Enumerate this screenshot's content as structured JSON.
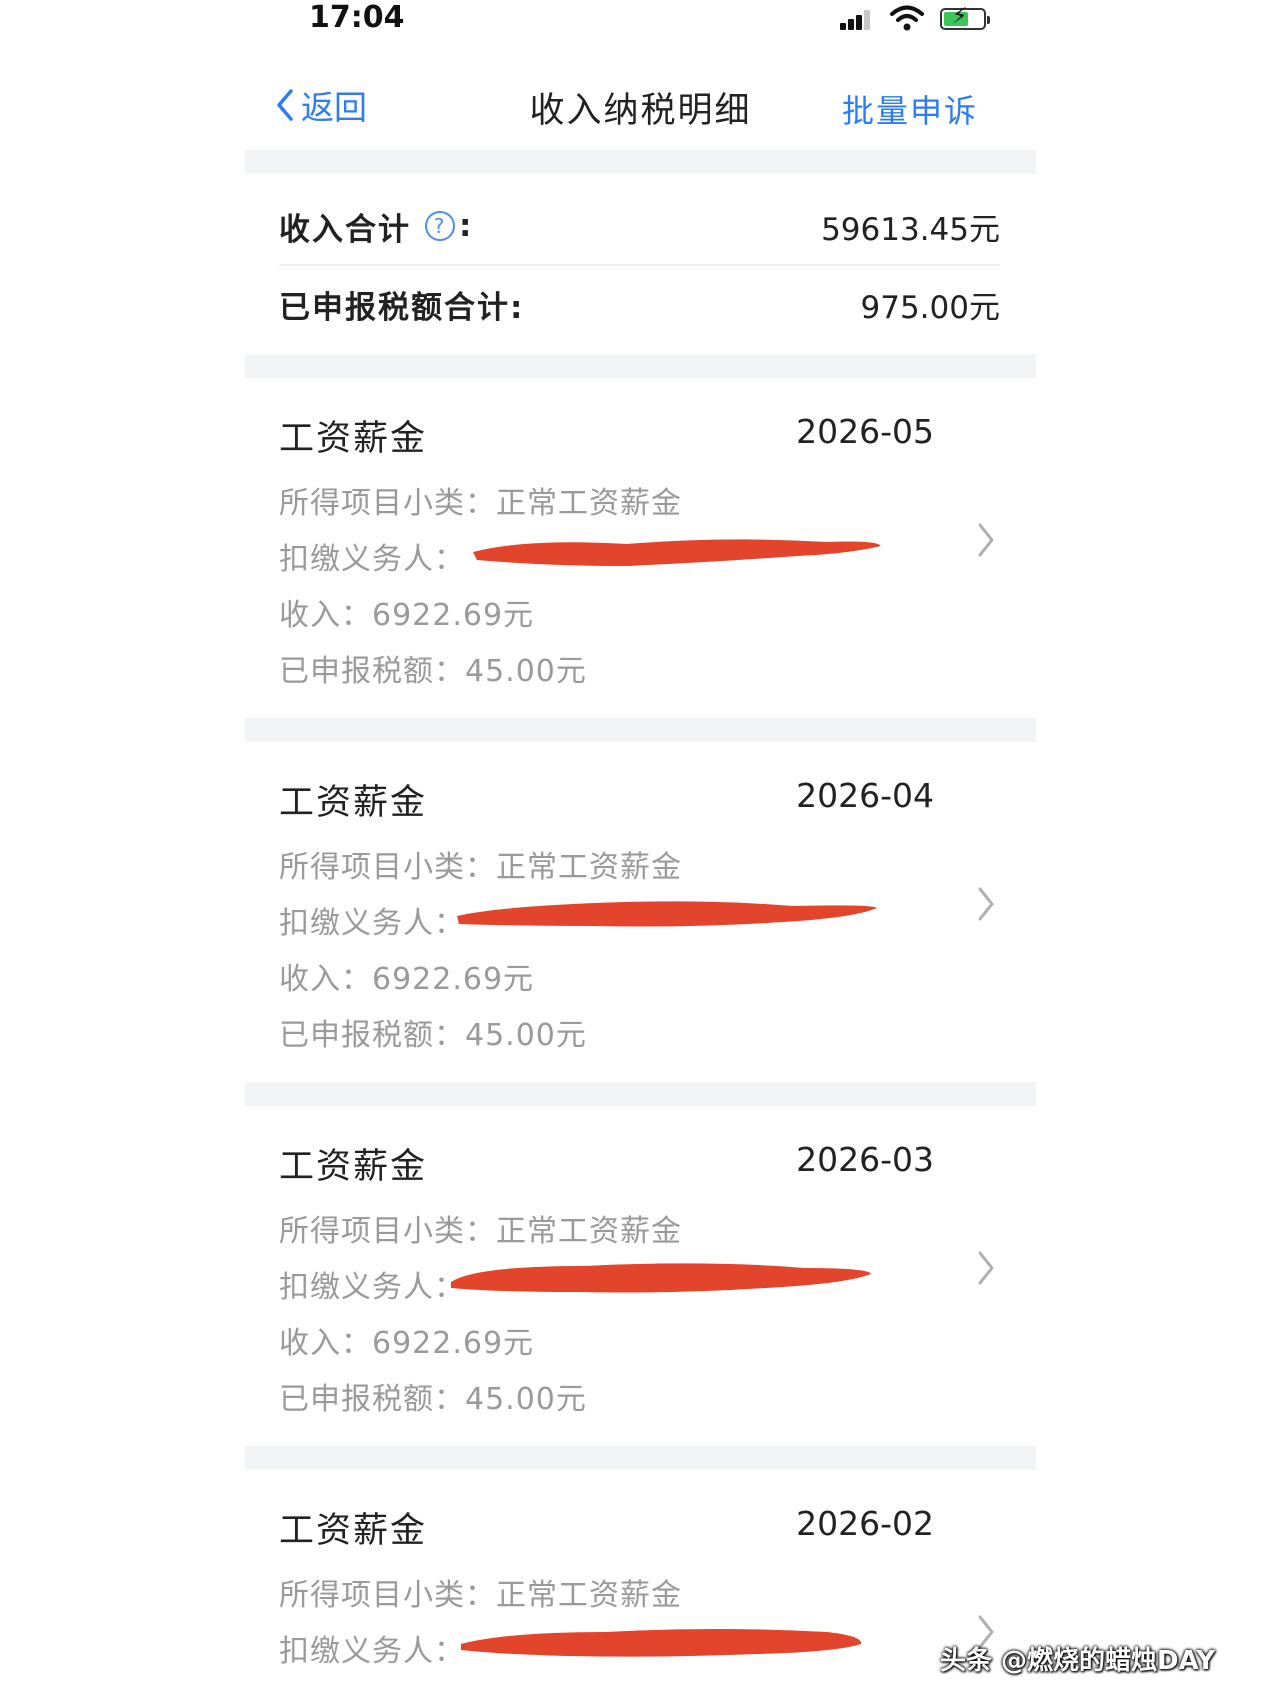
{
  "status_bar": {
    "time": "17:04"
  },
  "nav": {
    "back_label": "返回",
    "title": "收入纳税明细",
    "batch_label": "批量申诉"
  },
  "summary": {
    "income_label": "收入合计",
    "income_colon": ":",
    "income_value": "59613.45元",
    "tax_label": "已申报税额合计:",
    "tax_value": "975.00元"
  },
  "records": [
    {
      "title": "工资薪金",
      "period": "2026-05",
      "subcategory": "所得项目小类：正常工资薪金",
      "withholder_label": "扣缴义务人：",
      "income": "收入：6922.69元",
      "tax": "已申报税额：45.00元"
    },
    {
      "title": "工资薪金",
      "period": "2026-04",
      "subcategory": "所得项目小类：正常工资薪金",
      "withholder_label": "扣缴义务人：",
      "income": "收入：6922.69元",
      "tax": "已申报税额：45.00元"
    },
    {
      "title": "工资薪金",
      "period": "2026-03",
      "subcategory": "所得项目小类：正常工资薪金",
      "withholder_label": "扣缴义务人：",
      "income": "收入：6922.69元",
      "tax": "已申报税额：45.00元"
    },
    {
      "title": "工资薪金",
      "period": "2026-02",
      "subcategory": "所得项目小类：正常工资薪金",
      "withholder_label": "扣缴义务人："
    }
  ],
  "watermark": "头条 @燃烧的蜡烛DAY",
  "colors": {
    "accent": "#2d7cf6",
    "redaction": "#e2452b",
    "muted_text": "#9a9a9a",
    "band": "#f3f4f6"
  }
}
